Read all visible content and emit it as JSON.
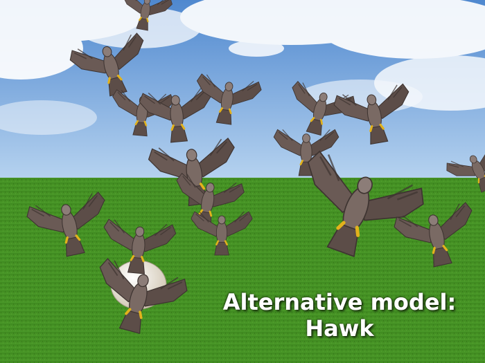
{
  "scene": {
    "caption_line1": "Alternative model:",
    "caption_line2": "Hawk",
    "subject": "hawk",
    "colors": {
      "sky_top": "#4f88cf",
      "sky_bottom": "#b8d4f0",
      "cloud": "#ffffff",
      "grass_light": "#4f9a2a",
      "grass_dark": "#2f6a14",
      "hawk_body": "#6a5a55",
      "hawk_dark": "#3e3431",
      "hawk_light": "#8c7d78",
      "talon": "#e2b21c",
      "egg": "#ece4d4",
      "caption_text": "#ffffff"
    }
  }
}
